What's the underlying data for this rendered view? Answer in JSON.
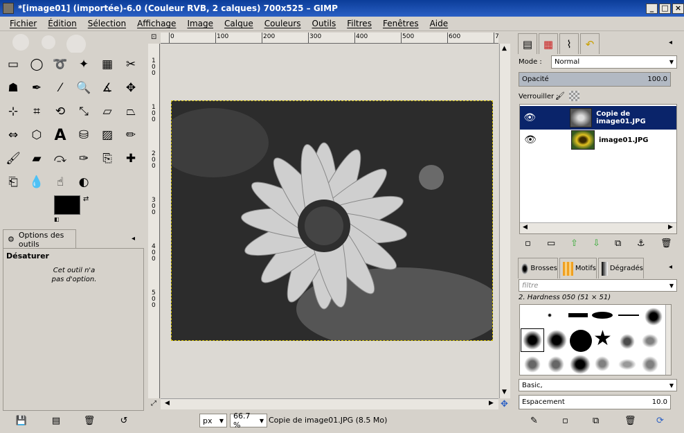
{
  "window": {
    "title": "*[image01] (importée)-6.0 (Couleur RVB, 2 calques) 700x525 – GIMP"
  },
  "menu": [
    "Fichier",
    "Édition",
    "Sélection",
    "Affichage",
    "Image",
    "Calque",
    "Couleurs",
    "Outils",
    "Filtres",
    "Fenêtres",
    "Aide"
  ],
  "toolbox": {
    "tool_icons": [
      "rect-select-icon",
      "ellipse-select-icon",
      "lasso-icon",
      "fuzzy-select-icon",
      "color-select-icon",
      "scissors-icon",
      "foreground-select-icon",
      "paths-icon",
      "color-picker-icon",
      "zoom-icon",
      "measure-icon",
      "move-icon",
      "align-icon",
      "crop-icon",
      "rotate-icon",
      "scale-icon",
      "shear-icon",
      "perspective-icon",
      "flip-icon",
      "cage-icon",
      "text-icon",
      "bucket-fill-icon",
      "blend-icon",
      "pencil-icon",
      "paintbrush-icon",
      "eraser-icon",
      "airbrush-icon",
      "ink-icon",
      "clone-icon",
      "heal-icon",
      "perspective-clone-icon",
      "blur-icon",
      "smudge-icon",
      "dodge-burn-icon"
    ],
    "fg_color": "#000000",
    "bg_color": "#ffffff",
    "options_tab": "Options des outils",
    "options_heading": "Désaturer",
    "options_note_1": "Cet outil n'a",
    "options_note_2": "pas d'option."
  },
  "rulers": {
    "h": [
      "0",
      "100",
      "200",
      "300",
      "400",
      "500",
      "600",
      "7"
    ],
    "v": [
      "1",
      "0",
      "0",
      "1",
      "0",
      "0",
      "2",
      "0",
      "0",
      "3",
      "0",
      "0",
      "4",
      "0",
      "0",
      "5",
      "0",
      "0"
    ]
  },
  "status": {
    "unit": "px",
    "zoom": "66.7 %",
    "message": "Copie de image01.JPG (8.5 Mo)"
  },
  "layers": {
    "mode_label": "Mode :",
    "mode_value": "Normal",
    "opacity_label": "Opacité",
    "opacity_value": "100.0",
    "opacity_fraction": 1.0,
    "lock_label": "Verrouiller :",
    "items": [
      {
        "name": "Copie de image01.JPG",
        "selected": true
      },
      {
        "name": "image01.JPG",
        "selected": false
      }
    ]
  },
  "brushes": {
    "tabs": [
      "Brosses",
      "Motifs",
      "Dégradés"
    ],
    "filter_placeholder": "filtre",
    "selected_name": "2. Hardness 050 (51 × 51)",
    "tag_value": "Basic,",
    "spacing_label": "Espacement",
    "spacing_value": "10.0",
    "spacing_fraction": 0.1
  },
  "colors": {
    "selection": "#0a246a",
    "accent": "#0b3d99"
  }
}
